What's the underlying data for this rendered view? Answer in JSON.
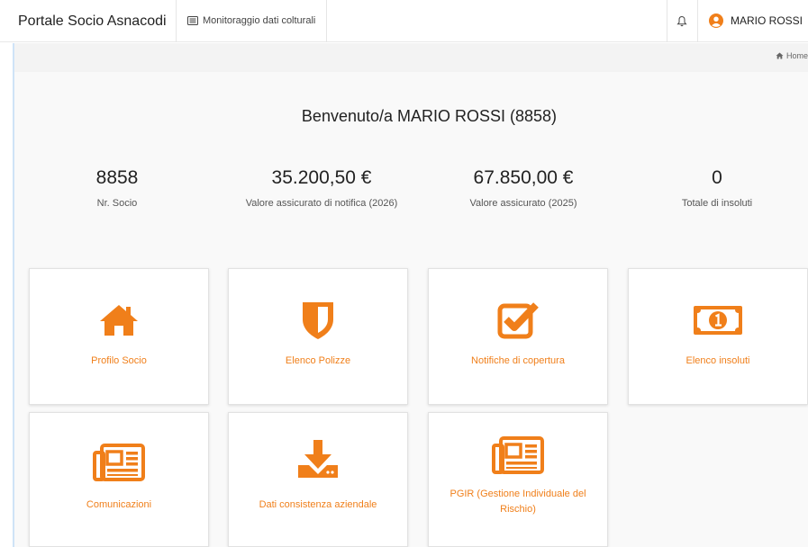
{
  "header": {
    "brand": "Portale Socio Asnacodi",
    "nav_link": "Monitoraggio dati colturali",
    "user_name": "MARIO ROSSI"
  },
  "breadcrumb": {
    "home": "Home"
  },
  "welcome": "Benvenuto/a MARIO ROSSI (8858)",
  "stats": [
    {
      "value": "8858",
      "label": "Nr. Socio"
    },
    {
      "value": "35.200,50 €",
      "label": "Valore assicurato di notifica (2026)"
    },
    {
      "value": "67.850,00 €",
      "label": "Valore assicurato (2025)"
    },
    {
      "value": "0",
      "label": "Totale di insoluti"
    }
  ],
  "cards": [
    {
      "label": "Profilo Socio",
      "icon": "home-icon"
    },
    {
      "label": "Elenco Polizze",
      "icon": "shield-icon"
    },
    {
      "label": "Notifiche di copertura",
      "icon": "checkbox-icon"
    },
    {
      "label": "Elenco insoluti",
      "icon": "money-icon"
    },
    {
      "label": "Comunicazioni",
      "icon": "newspaper-icon"
    },
    {
      "label": "Dati consistenza aziendale",
      "icon": "download-icon"
    },
    {
      "label": "PGIR (Gestione Individuale del Rischio)",
      "icon": "newspaper-icon"
    }
  ],
  "colors": {
    "accent": "#f07f1a",
    "avatar": "#f07f1a"
  }
}
